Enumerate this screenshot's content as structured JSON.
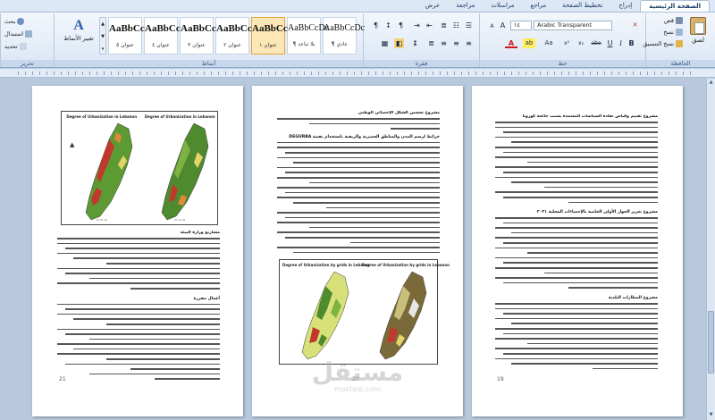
{
  "tabs": [
    "الصفحة الرئيسية",
    "إدراج",
    "تخطيط الصفحة",
    "مراجع",
    "مراسلات",
    "مراجعة",
    "عرض"
  ],
  "active_tab_index": 0,
  "clipboard": {
    "paste_label": "لصق",
    "cut_label": "قص",
    "copy_label": "نسخ",
    "format_painter_label": "نسخ التنسيق",
    "group_label": "الحافظة"
  },
  "font": {
    "name_value": "Arabic Transparent",
    "size_value": "١٤",
    "group_label": "خط",
    "bold": "B",
    "italic": "I",
    "underline": "U",
    "strike": "abe",
    "subscript": "x₂",
    "superscript": "x²",
    "change_case": "Aa",
    "grow": "A",
    "shrink": "A",
    "highlight": "ab",
    "font_color": "A"
  },
  "paragraph": {
    "group_label": "فقرة"
  },
  "styles": {
    "group_label": "أنماط",
    "items": [
      {
        "sample": "AaBbCcDc",
        "name": "¶ عادي"
      },
      {
        "sample": "AaBbCcDc",
        "name": "¶ بلا تباعد"
      },
      {
        "sample": "AaBbCc",
        "name": "عنوان ١"
      },
      {
        "sample": "AaBbCc",
        "name": "عنوان ٢"
      },
      {
        "sample": "AaBbCc",
        "name": "عنوان ٣"
      },
      {
        "sample": "AaBbCc",
        "name": "عنوان ٤"
      },
      {
        "sample": "AaBbCc",
        "name": "عنوان ٥"
      }
    ],
    "change_styles_label": "تغيير الأنماط"
  },
  "editing": {
    "group_label": "تحرير",
    "find_label": "بحث",
    "replace_label": "استبدال",
    "select_label": "تحديد"
  },
  "pages": [
    {
      "number": "19",
      "sections": [
        "مشروع تقييم وقياس تفادة السياسات المعتمدة بسبب جائحة كورونا",
        "مشروع تعزيز الحوار الأولي الخاصة بالإحصاءات المحلية ٢٠٢١",
        "مشروع المطارات البلدية"
      ]
    },
    {
      "number": "20",
      "sections": [
        "مشروع تحسين الشكل الإحصائي الوطني",
        "خرائط لرسم المدن والمناطق الحضرية والريفية باستخدام تقنية DEGURBA"
      ],
      "map_title": "Degree of Urbanization by grids in Lebanon"
    },
    {
      "number": "21",
      "sections": [
        "مشاريع وزارة البيئة",
        "أعمال مقررة"
      ],
      "map_title": "Degree of Urbanization in Lebanon"
    }
  ],
  "watermark": {
    "main": "مستقل",
    "sub": "mostaql.com"
  },
  "colors": {
    "tab_bg": "#dde8f6",
    "workspace": "#b9c9dd",
    "selected_style": "#fde7b6",
    "map_green": "#4f8a2e",
    "map_red": "#c0392b",
    "map_yellow": "#e6d36a",
    "map_orange": "#e08a3a"
  }
}
